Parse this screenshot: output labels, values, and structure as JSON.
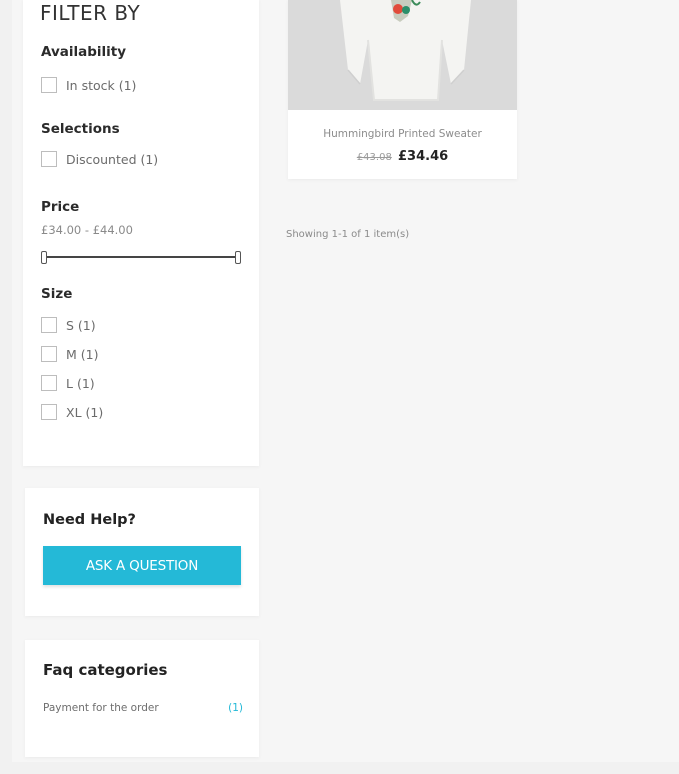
{
  "filter": {
    "title": "FILTER BY",
    "availability": {
      "title": "Availability",
      "options": [
        {
          "label": "In stock (1)"
        }
      ]
    },
    "selections": {
      "title": "Selections",
      "options": [
        {
          "label": "Discounted (1)"
        }
      ]
    },
    "price": {
      "title": "Price",
      "range": "£34.00 - £44.00",
      "slider_min": 34.0,
      "slider_max": 44.0
    },
    "size": {
      "title": "Size",
      "options": [
        {
          "label": "S (1)"
        },
        {
          "label": "M (1)"
        },
        {
          "label": "L (1)"
        },
        {
          "label": "XL (1)"
        }
      ]
    }
  },
  "help": {
    "title": "Need Help?",
    "button_label": "ASK A QUESTION"
  },
  "faq": {
    "title": "Faq categories",
    "items": [
      {
        "label": "Payment for the order",
        "count": "(1)"
      }
    ]
  },
  "product": {
    "name": "Hummingbird Printed Sweater",
    "old_price": "£43.08",
    "new_price": "£34.46"
  },
  "results": {
    "showing": "Showing 1-1 of 1 item(s)"
  },
  "colors": {
    "accent": "#24b9d7",
    "background": "#f6f6f6"
  }
}
